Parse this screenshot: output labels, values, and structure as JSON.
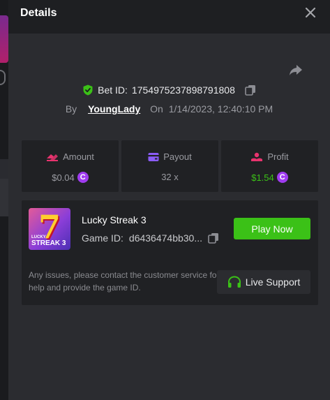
{
  "header": {
    "title": "Details"
  },
  "bet": {
    "id_label": "Bet ID:",
    "id_value": "1754975237898791808",
    "by_label": "By",
    "username": "YoungLady",
    "on_label": "On",
    "datetime": "1/14/2023, 12:40:10 PM"
  },
  "stats": {
    "amount": {
      "label": "Amount",
      "value": "$0.04",
      "icon": "amount-icon"
    },
    "payout": {
      "label": "Payout",
      "value": "32 x",
      "icon": "payout-icon"
    },
    "profit": {
      "label": "Profit",
      "value": "$1.54",
      "icon": "profit-icon"
    }
  },
  "coin_symbol": "C",
  "game": {
    "name": "Lucky Streak 3",
    "id_label": "Game ID:",
    "id_value": "d6436474bb30...",
    "thumb_caption_top": "LUCKY",
    "thumb_caption_bottom": "STREAK 3",
    "thumb_glyph": "7",
    "play_label": "Play Now"
  },
  "support": {
    "message": "Any issues, please contact the customer service for help and provide the game ID.",
    "button_label": "Live Support"
  },
  "colors": {
    "accent_green": "#3bc117",
    "coin_purple": "#a03cf0",
    "shield_green": "#3bc117",
    "amount_pink": "#e8336e",
    "payout_purple": "#8b5cf6",
    "profit_red": "#e8336e"
  }
}
